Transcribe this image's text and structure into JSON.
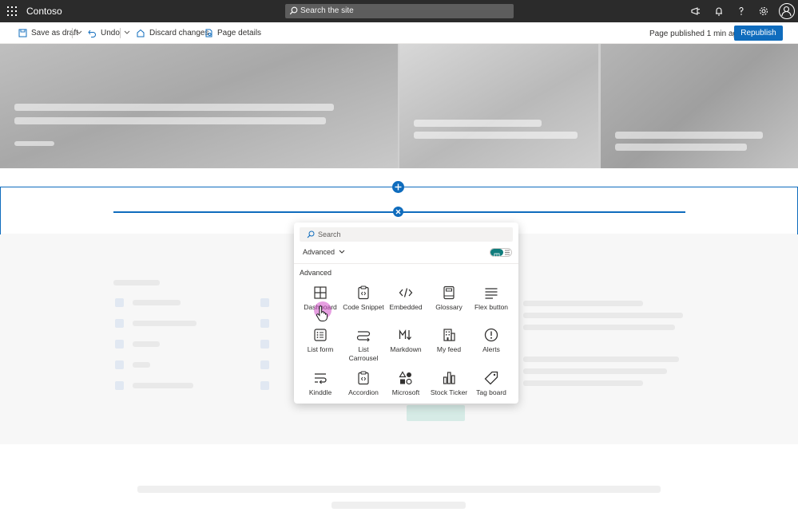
{
  "suite": {
    "site_name": "Contoso",
    "search_placeholder": "Search the site"
  },
  "command_bar": {
    "save_draft": "Save as draft",
    "undo": "Undo",
    "discard": "Discard changes",
    "page_details": "Page details",
    "status": "Page published 1 min ago",
    "republish": "Republish"
  },
  "toolbox": {
    "search_placeholder": "Search",
    "filter_label": "Advanced",
    "group_label": "Advanced",
    "parts": [
      {
        "label": "Dashboard",
        "icon": "dashboard-icon"
      },
      {
        "label": "Code Snippet",
        "icon": "code-snippet-icon"
      },
      {
        "label": "Embedded",
        "icon": "embed-code-icon"
      },
      {
        "label": "Glossary",
        "icon": "glossary-book-icon"
      },
      {
        "label": "Flex button",
        "icon": "lines-icon"
      },
      {
        "label": "List form",
        "icon": "list-form-icon"
      },
      {
        "label": "List Carrousel",
        "icon": "carousel-arrows-icon"
      },
      {
        "label": "Markdown",
        "icon": "markdown-icon"
      },
      {
        "label": "My feed",
        "icon": "building-icon"
      },
      {
        "label": "Alerts",
        "icon": "alert-icon"
      },
      {
        "label": "Kinddle",
        "icon": "wrap-text-icon"
      },
      {
        "label": "Accordion",
        "icon": "clipboard-code-icon"
      },
      {
        "label": "Microsoft",
        "icon": "shapes-icon"
      },
      {
        "label": "Stock Ticker",
        "icon": "bar-chart-icon"
      },
      {
        "label": "Tag board",
        "icon": "tag-icon"
      }
    ]
  },
  "colors": {
    "brand": "#0f6cbd",
    "suite_bar": "#2b2b2b",
    "toggle_on": "#0f7c7c"
  }
}
